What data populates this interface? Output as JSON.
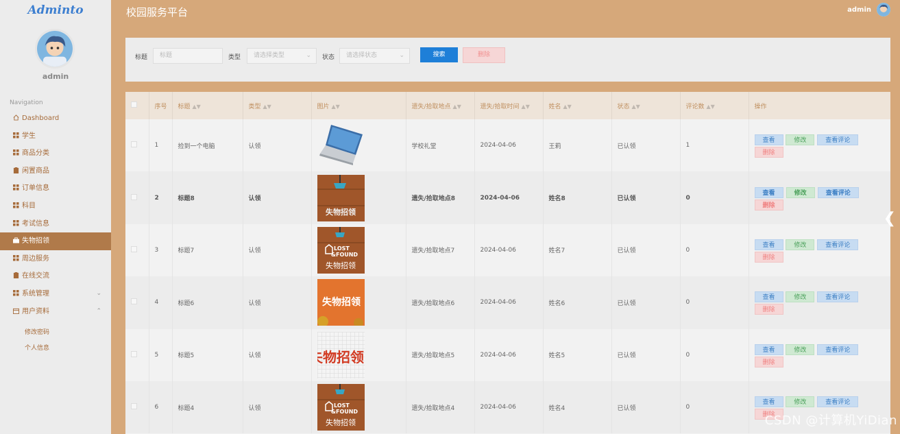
{
  "app": {
    "logo": "Adminto",
    "title": "校园服务平台",
    "user": "admin",
    "watermark": "CSDN @计算机YiDian"
  },
  "sidebar": {
    "username": "admin",
    "nav_title": "Navigation",
    "items": [
      {
        "label": "Dashboard",
        "icon": "home-icon"
      },
      {
        "label": "学生",
        "icon": "grid-icon"
      },
      {
        "label": "商品分类",
        "icon": "grid-icon"
      },
      {
        "label": "闲置商品",
        "icon": "clipboard-icon"
      },
      {
        "label": "订单信息",
        "icon": "grid-icon"
      },
      {
        "label": "科目",
        "icon": "grid-icon"
      },
      {
        "label": "考试信息",
        "icon": "grid-icon"
      },
      {
        "label": "失物招领",
        "icon": "briefcase-icon",
        "active": true
      },
      {
        "label": "周边服务",
        "icon": "grid-icon"
      },
      {
        "label": "在线交流",
        "icon": "clipboard-icon"
      },
      {
        "label": "系统管理",
        "icon": "grid-icon",
        "chevron": "down"
      },
      {
        "label": "用户资料",
        "icon": "calendar-icon",
        "chevron": "up"
      }
    ],
    "subitems": [
      "修改密码",
      "个人信息"
    ]
  },
  "search": {
    "title_label": "标题",
    "title_placeholder": "标题",
    "type_label": "类型",
    "type_placeholder": "请选择类型",
    "status_label": "状态",
    "status_placeholder": "请选择状态",
    "search_button": "搜索",
    "delete_button": "删除"
  },
  "table": {
    "columns": [
      "序号",
      "标题",
      "类型",
      "图片",
      "遗失/拾取地点",
      "遗失/拾取时间",
      "姓名",
      "状态",
      "评论数",
      "操作"
    ],
    "actions": {
      "view": "查看",
      "edit": "修改",
      "comments": "查看评论",
      "delete": "删除"
    },
    "rows": [
      {
        "no": "1",
        "title": "捡到一个电脑",
        "type": "认领",
        "image": "laptop",
        "place": "学校礼堂",
        "time": "2024-04-06",
        "name": "王莉",
        "status": "已认领",
        "comments": "1"
      },
      {
        "no": "2",
        "title": "标题8",
        "type": "认领",
        "image": "wood",
        "place": "遗失/拾取地点8",
        "time": "2024-04-06",
        "name": "姓名8",
        "status": "已认领",
        "comments": "0"
      },
      {
        "no": "3",
        "title": "标题7",
        "type": "认领",
        "image": "lostfound",
        "place": "遗失/拾取地点7",
        "time": "2024-04-06",
        "name": "姓名7",
        "status": "已认领",
        "comments": "0"
      },
      {
        "no": "4",
        "title": "标题6",
        "type": "认领",
        "image": "orange",
        "place": "遗失/拾取地点6",
        "time": "2024-04-06",
        "name": "姓名6",
        "status": "已认领",
        "comments": "0"
      },
      {
        "no": "5",
        "title": "标题5",
        "type": "认领",
        "image": "grid",
        "place": "遗失/拾取地点5",
        "time": "2024-04-06",
        "name": "姓名5",
        "status": "已认领",
        "comments": "0"
      },
      {
        "no": "6",
        "title": "标题4",
        "type": "认领",
        "image": "lostfound",
        "place": "遗失/拾取地点4",
        "time": "2024-04-06",
        "name": "姓名4",
        "status": "已认领",
        "comments": "0"
      }
    ],
    "image_texts": {
      "wood": "失物招领",
      "lostfound_l1": "LOST",
      "lostfound_l2": "&FOUND",
      "lostfound_cn": "失物招领",
      "orange": "失物招领",
      "grid": "失物招领"
    }
  }
}
